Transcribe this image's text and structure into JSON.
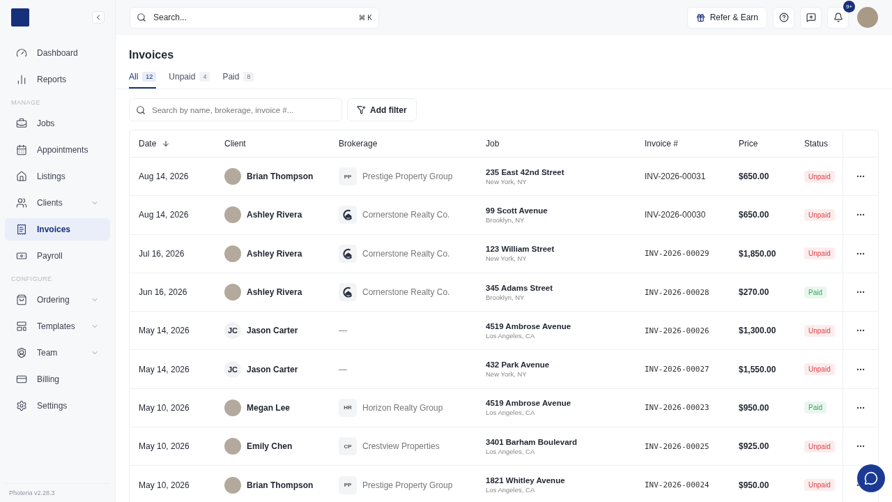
{
  "sidebar": {
    "groups": [
      {
        "items": [
          {
            "label": "Dashboard",
            "selected": false,
            "expandable": false
          },
          {
            "label": "Reports",
            "selected": false,
            "expandable": false
          }
        ]
      },
      {
        "heading": "MANAGE",
        "items": [
          {
            "label": "Jobs",
            "selected": false,
            "expandable": false
          },
          {
            "label": "Appointments",
            "selected": false,
            "expandable": false
          },
          {
            "label": "Listings",
            "selected": false,
            "expandable": false
          },
          {
            "label": "Clients",
            "selected": false,
            "expandable": true
          },
          {
            "label": "Invoices",
            "selected": true,
            "expandable": false
          },
          {
            "label": "Payroll",
            "selected": false,
            "expandable": false
          }
        ]
      },
      {
        "heading": "CONFIGURE",
        "items": [
          {
            "label": "Ordering",
            "selected": false,
            "expandable": true
          },
          {
            "label": "Templates",
            "selected": false,
            "expandable": true
          },
          {
            "label": "Team",
            "selected": false,
            "expandable": true
          },
          {
            "label": "Billing",
            "selected": false,
            "expandable": false
          },
          {
            "label": "Settings",
            "selected": false,
            "expandable": false
          }
        ]
      }
    ],
    "version": "Photeria v2.28.3"
  },
  "topbar": {
    "search": {
      "placeholder": "Search...",
      "shortcut": [
        "⌘",
        "K"
      ]
    },
    "refer_button": "Refer & Earn",
    "notification_badge": "9+"
  },
  "page": {
    "title": "Invoices",
    "tabs": [
      {
        "label": "All",
        "count": "12",
        "selected": true
      },
      {
        "label": "Unpaid",
        "count": "4",
        "selected": false
      },
      {
        "label": "Paid",
        "count": "8",
        "selected": false
      }
    ],
    "filter_search": {
      "placeholder": "Search by name, brokerage, invoice #..."
    },
    "filter_button": "Add filter"
  },
  "table": {
    "columns": [
      "Date",
      "Client",
      "Brokerage",
      "Job",
      "Invoice #",
      "Price",
      "Status"
    ],
    "rows": [
      {
        "date": "Aug 14, 2026",
        "client": {
          "kind": "photo",
          "name": "Brian Thompson"
        },
        "brokerage": {
          "kind": "initials",
          "initials": "PP",
          "name": "Prestige Property Group"
        },
        "job": {
          "address": "235 East 42nd Street",
          "city": "New York, NY"
        },
        "invoice": "INV-2026-00031",
        "monospace": false,
        "price": "$650.00",
        "status": {
          "kind": "unpaid",
          "label": "Unpaid"
        }
      },
      {
        "date": "Aug 14, 2026",
        "client": {
          "kind": "photo",
          "name": "Ashley Rivera"
        },
        "brokerage": {
          "kind": "logo",
          "name": "Cornerstone Realty Co."
        },
        "job": {
          "address": "99 Scott Avenue",
          "city": "Brooklyn, NY"
        },
        "invoice": "INV-2026-00030",
        "monospace": false,
        "price": "$650.00",
        "status": {
          "kind": "unpaid",
          "label": "Unpaid"
        }
      },
      {
        "date": "Jul 16, 2026",
        "client": {
          "kind": "photo",
          "name": "Ashley Rivera"
        },
        "brokerage": {
          "kind": "logo",
          "name": "Cornerstone Realty Co."
        },
        "job": {
          "address": "123 William Street",
          "city": "New York, NY"
        },
        "invoice": "INV-2026-00029",
        "monospace": true,
        "price": "$1,850.00",
        "status": {
          "kind": "unpaid",
          "label": "Unpaid"
        }
      },
      {
        "date": "Jun 16, 2026",
        "client": {
          "kind": "photo",
          "name": "Ashley Rivera"
        },
        "brokerage": {
          "kind": "logo",
          "name": "Cornerstone Realty Co."
        },
        "job": {
          "address": "345 Adams Street",
          "city": "Brooklyn, NY"
        },
        "invoice": "INV-2026-00028",
        "monospace": true,
        "price": "$270.00",
        "status": {
          "kind": "paid",
          "label": "Paid"
        }
      },
      {
        "date": "May 14, 2026",
        "client": {
          "kind": "initials",
          "initials": "JC",
          "name": "Jason Carter"
        },
        "brokerage": {
          "kind": "none",
          "name": "—"
        },
        "job": {
          "address": "4519 Ambrose Avenue",
          "city": "Los Angeles, CA"
        },
        "invoice": "INV-2026-00026",
        "monospace": true,
        "price": "$1,300.00",
        "status": {
          "kind": "unpaid",
          "label": "Unpaid"
        }
      },
      {
        "date": "May 14, 2026",
        "client": {
          "kind": "initials",
          "initials": "JC",
          "name": "Jason Carter"
        },
        "brokerage": {
          "kind": "none",
          "name": "—"
        },
        "job": {
          "address": "432 Park Avenue",
          "city": "New York, NY"
        },
        "invoice": "INV-2026-00027",
        "monospace": true,
        "price": "$1,550.00",
        "status": {
          "kind": "unpaid",
          "label": "Unpaid"
        }
      },
      {
        "date": "May 10, 2026",
        "client": {
          "kind": "photo",
          "name": "Megan Lee"
        },
        "brokerage": {
          "kind": "initials",
          "initials": "HR",
          "name": "Horizon Realty Group"
        },
        "job": {
          "address": "4519 Ambrose Avenue",
          "city": "Los Angeles, CA"
        },
        "invoice": "INV-2026-00023",
        "monospace": true,
        "price": "$950.00",
        "status": {
          "kind": "paid",
          "label": "Paid"
        }
      },
      {
        "date": "May 10, 2026",
        "client": {
          "kind": "photo",
          "name": "Emily Chen"
        },
        "brokerage": {
          "kind": "initials",
          "initials": "CP",
          "name": "Crestview Properties"
        },
        "job": {
          "address": "3401 Barham Boulevard",
          "city": "Los Angeles, CA"
        },
        "invoice": "INV-2026-00025",
        "monospace": true,
        "price": "$925.00",
        "status": {
          "kind": "unpaid",
          "label": "Unpaid"
        }
      },
      {
        "date": "May 10, 2026",
        "client": {
          "kind": "photo",
          "name": "Brian Thompson"
        },
        "brokerage": {
          "kind": "initials",
          "initials": "PP",
          "name": "Prestige Property Group"
        },
        "job": {
          "address": "1821 Whitley Avenue",
          "city": "Los Angeles, CA"
        },
        "invoice": "INV-2026-00024",
        "monospace": true,
        "price": "$950.00",
        "status": {
          "kind": "unpaid",
          "label": "Unpaid"
        }
      }
    ]
  }
}
